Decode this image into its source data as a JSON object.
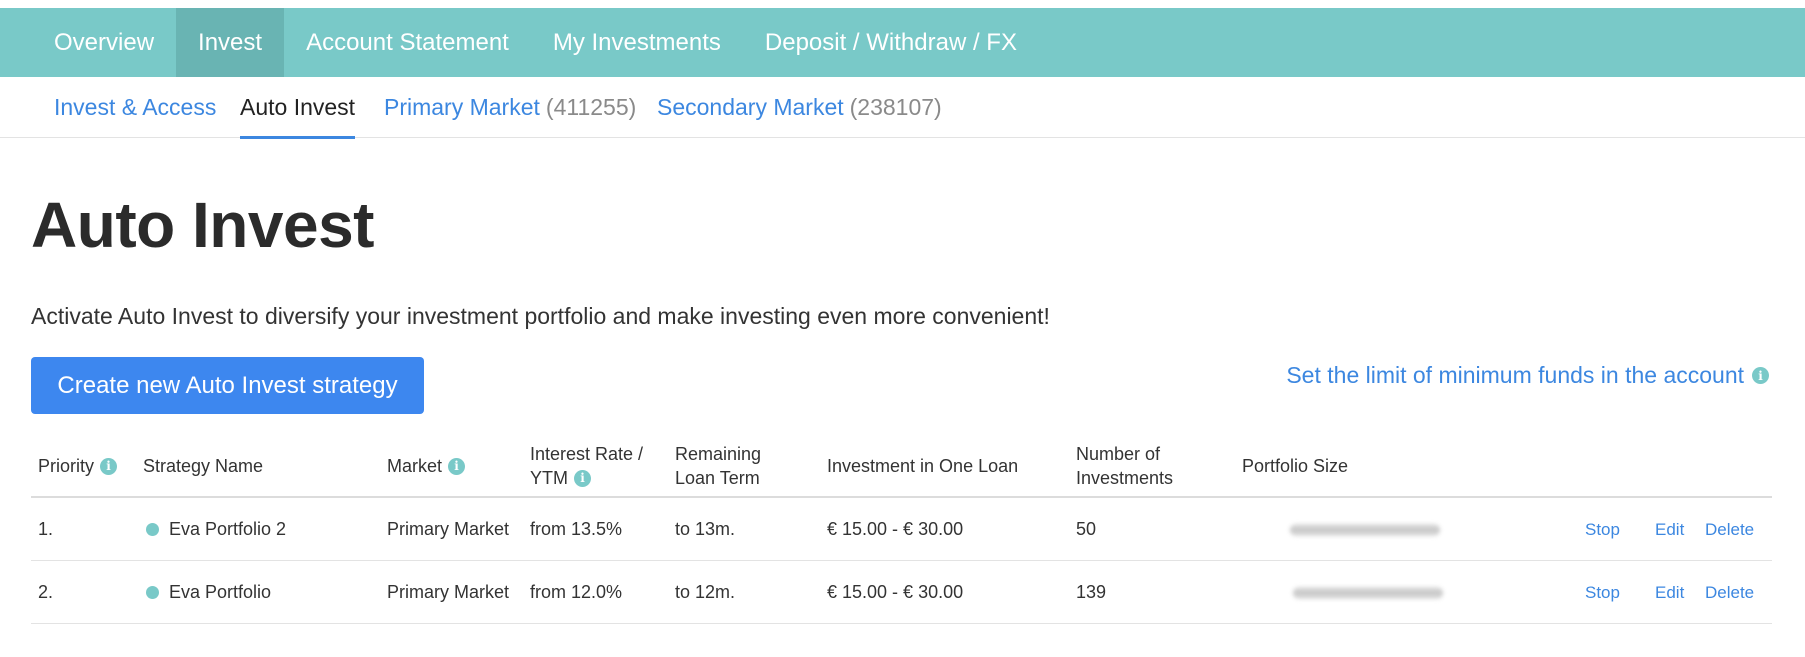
{
  "topnav": {
    "items": [
      "Overview",
      "Invest",
      "Account Statement",
      "My Investments",
      "Deposit / Withdraw / FX"
    ],
    "active": "Invest"
  },
  "subnav": {
    "invest_access": "Invest & Access",
    "auto_invest": "Auto Invest",
    "primary_market": "Primary Market",
    "primary_count": "(411255)",
    "secondary_market": "Secondary Market",
    "secondary_count": "(238107)"
  },
  "page": {
    "title": "Auto Invest",
    "intro": "Activate Auto Invest to diversify your investment portfolio and make investing even more convenient!",
    "create_button": "Create new Auto Invest strategy",
    "limit_link": "Set the limit of minimum funds in the account"
  },
  "table": {
    "headers": {
      "priority": "Priority",
      "strategy_name": "Strategy Name",
      "market": "Market",
      "interest_line1": "Interest Rate /",
      "interest_line2": "YTM",
      "term_line1": "Remaining",
      "term_line2": "Loan Term",
      "investment": "Investment in One Loan",
      "number_line1": "Number of",
      "number_line2": "Investments",
      "portfolio_size": "Portfolio Size"
    },
    "rows": [
      {
        "priority": "1.",
        "name": "Eva Portfolio 2",
        "market": "Primary Market",
        "rate": "from 13.5%",
        "term": "to 13m.",
        "investment": "€ 15.00 - € 30.00",
        "count": "50",
        "stop": "Stop",
        "edit": "Edit",
        "delete": "Delete"
      },
      {
        "priority": "2.",
        "name": "Eva Portfolio",
        "market": "Primary Market",
        "rate": "from 12.0%",
        "term": "to 12m.",
        "investment": "€ 15.00 - € 30.00",
        "count": "139",
        "stop": "Stop",
        "edit": "Edit",
        "delete": "Delete"
      }
    ]
  },
  "icons": {
    "info": "info-icon",
    "status_dot": "status-dot-icon"
  },
  "colors": {
    "teal": "#79c9c8",
    "teal_active": "#69b4b3",
    "link_blue": "#3c87e0",
    "button_blue": "#3d87ef"
  }
}
